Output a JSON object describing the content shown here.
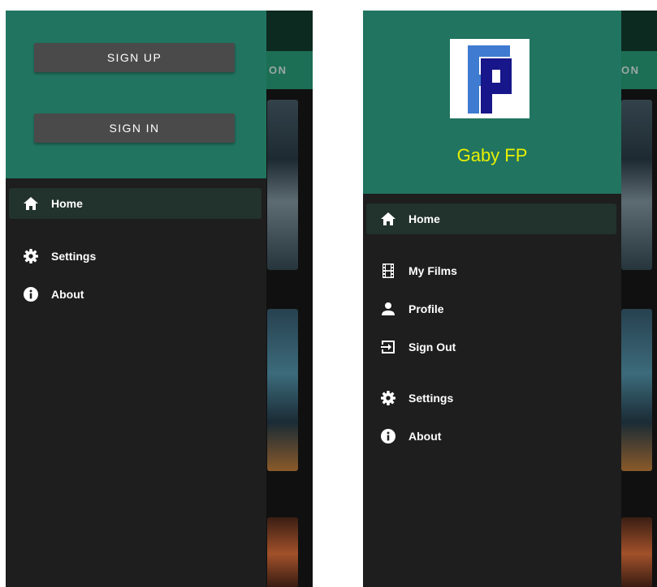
{
  "left_screen": {
    "background_tab_label": "ON",
    "auth": {
      "signup_label": "SIGN UP",
      "signin_label": "SIGN IN"
    },
    "nav": [
      {
        "label": "Home",
        "icon": "home-icon",
        "active": true
      },
      {
        "label": "Settings",
        "icon": "gear-icon"
      },
      {
        "label": "About",
        "icon": "info-icon"
      }
    ]
  },
  "right_screen": {
    "background_tab_label": "ON",
    "profile": {
      "name": "Gaby FP",
      "name_color": "#e8f000",
      "avatar": "FP logo"
    },
    "nav": [
      {
        "label": "Home",
        "icon": "home-icon",
        "active": true
      },
      {
        "label": "My Films",
        "icon": "film-icon"
      },
      {
        "label": "Profile",
        "icon": "person-icon"
      },
      {
        "label": "Sign Out",
        "icon": "sign-out-icon"
      },
      {
        "label": "Settings",
        "icon": "gear-icon"
      },
      {
        "label": "About",
        "icon": "info-icon"
      }
    ]
  },
  "colors": {
    "header": "#217560",
    "drawer": "#1e1e1e",
    "active_item": "#22322c",
    "button": "#4a4a4a"
  }
}
